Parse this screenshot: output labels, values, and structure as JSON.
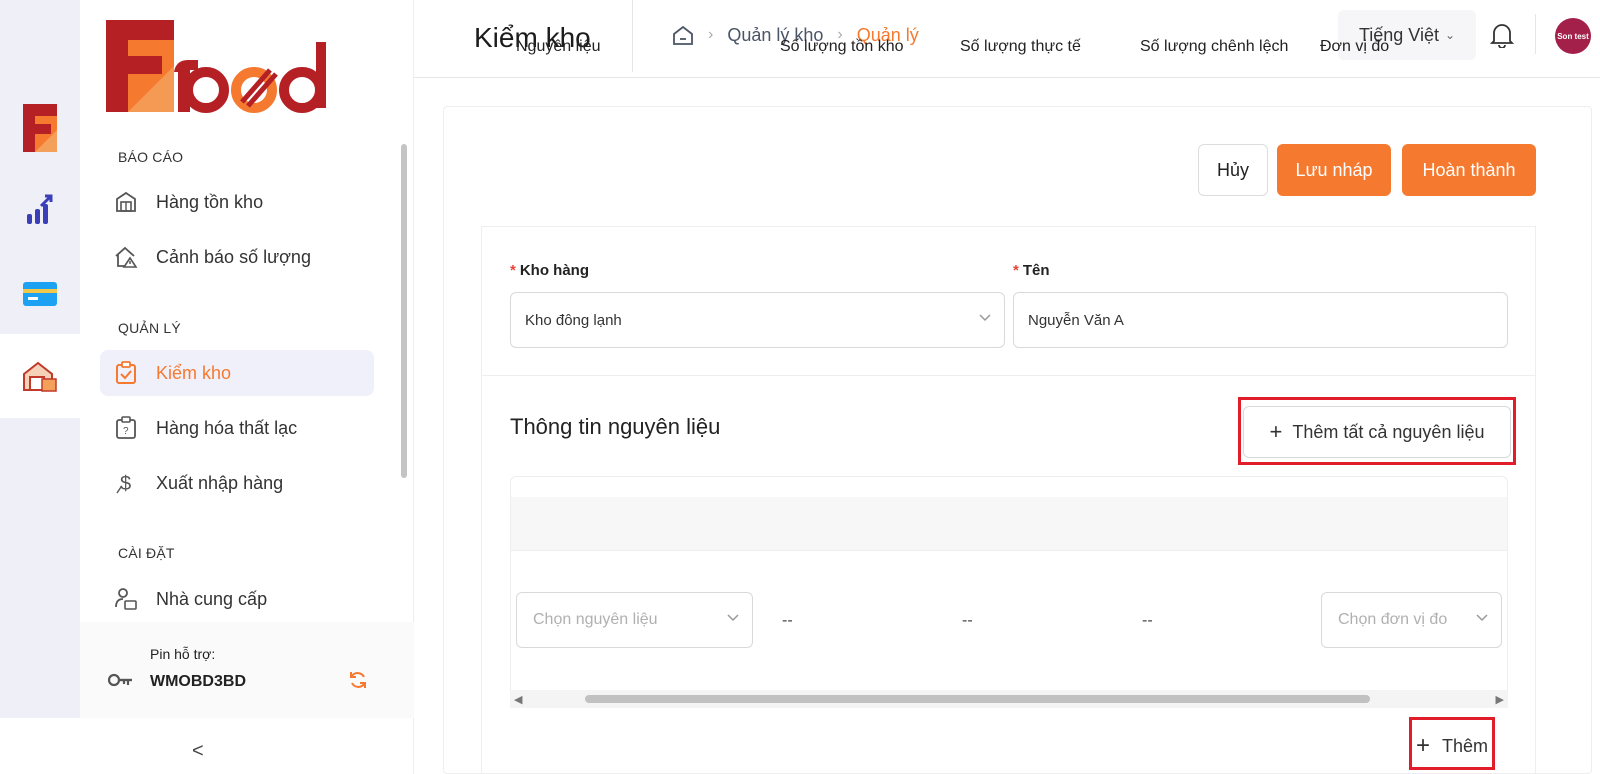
{
  "rail": {
    "items": [
      {
        "icon": "logo-f-icon",
        "active": false
      },
      {
        "icon": "report-chart-icon",
        "active": false
      },
      {
        "icon": "card-icon",
        "active": false
      },
      {
        "icon": "warehouse-icon",
        "active": true
      }
    ]
  },
  "sidebar": {
    "sections": {
      "report": "BÁO CÁO",
      "manage": "QUẢN LÝ",
      "settings": "CÀI ĐẶT"
    },
    "items": [
      {
        "label": "Hàng tồn kho",
        "icon": "inventory-icon"
      },
      {
        "label": "Cảnh báo số lượng",
        "icon": "warning-house-icon"
      },
      {
        "label": "Kiểm kho",
        "icon": "check-clipboard-icon",
        "active": true
      },
      {
        "label": "Hàng hóa thất lạc",
        "icon": "lost-goods-icon"
      },
      {
        "label": "Xuất nhập hàng",
        "icon": "dollar-icon"
      },
      {
        "label": "Nhà cung cấp",
        "icon": "supplier-icon"
      }
    ],
    "pin_label": "Pin hỗ trợ:",
    "pin_code": "WMOBD3BD",
    "collapse": "<"
  },
  "header": {
    "title": "Kiểm kho",
    "breadcrumb": [
      "Quản lý kho",
      "Quản lý"
    ],
    "language": "Tiếng Việt",
    "avatar_text": "Son test"
  },
  "actions": {
    "cancel": "Hủy",
    "draft": "Lưu nháp",
    "done": "Hoàn thành"
  },
  "form": {
    "warehouse_label": "Kho hàng",
    "warehouse_value": "Kho đông lạnh",
    "name_label": "Tên",
    "name_value": "Nguyễn Văn A"
  },
  "materials": {
    "heading": "Thông tin nguyên liệu",
    "add_all": "Thêm tất cả nguyên liệu",
    "columns": [
      "Nguyên liệu",
      "Số lượng tồn kho",
      "Số lượng thực tế",
      "Số lượng chênh lệch",
      "Đơn vị đo"
    ],
    "row": {
      "material_placeholder": "Chọn nguyên liệu",
      "stock": "--",
      "actual": "--",
      "diff": "--",
      "unit_placeholder": "Chọn đơn vị đo"
    },
    "add": "Thêm"
  },
  "colors": {
    "accent": "#f5792f",
    "highlight": "#e11d2a",
    "required": "#e8443a"
  }
}
